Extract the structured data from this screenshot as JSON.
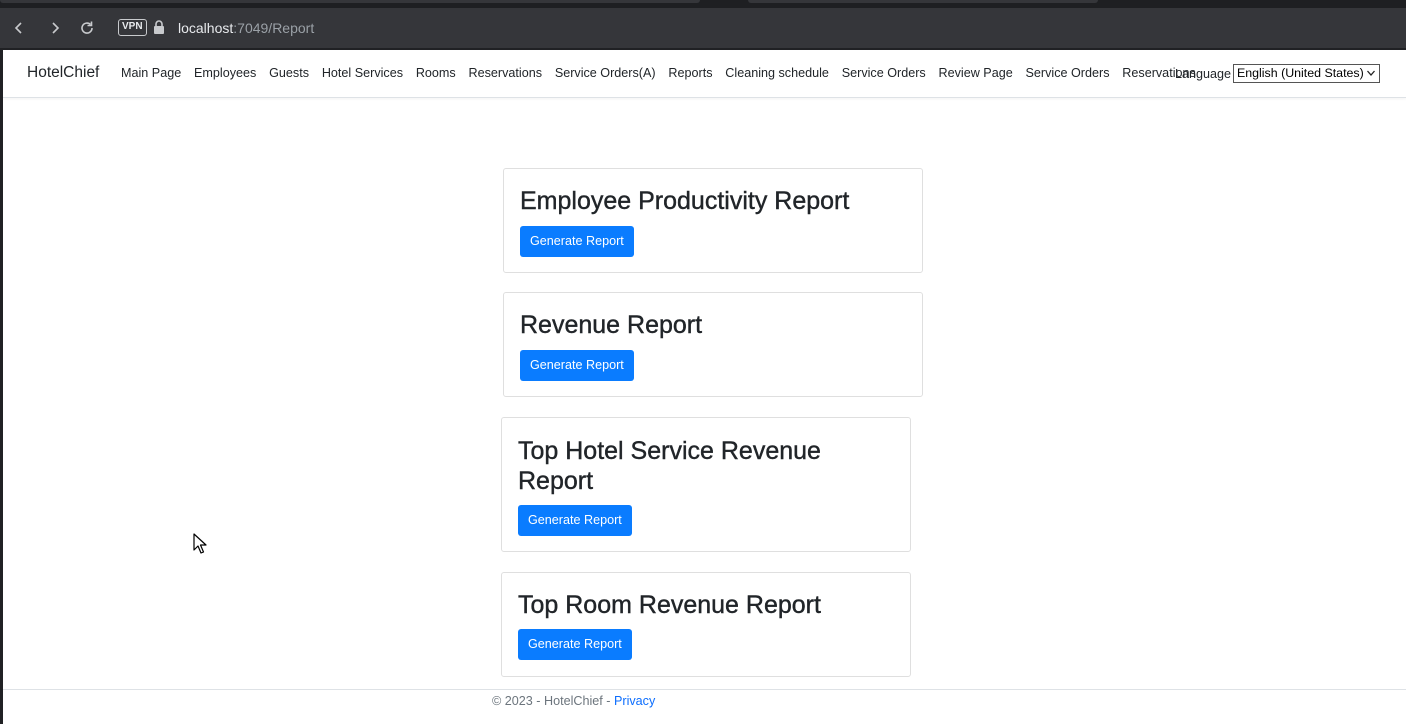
{
  "browser": {
    "url_host": "localhost",
    "url_path": ":7049/Report",
    "vpn_label": "VPN"
  },
  "navbar": {
    "brand": "HotelChief",
    "items": [
      {
        "label": "Main Page"
      },
      {
        "label": "Employees"
      },
      {
        "label": "Guests"
      },
      {
        "label": "Hotel Services"
      },
      {
        "label": "Rooms"
      },
      {
        "label": "Reservations"
      },
      {
        "label": "Service Orders(A)"
      },
      {
        "label": "Reports"
      },
      {
        "label": "Cleaning schedule"
      },
      {
        "label": "Service Orders"
      },
      {
        "label": "Review Page"
      },
      {
        "label": "Service Orders"
      },
      {
        "label": "Reservations"
      }
    ],
    "language_label": "Language",
    "language_selected": "English (United States)"
  },
  "reports": [
    {
      "title": "Employee Productivity Report",
      "button": "Generate Report"
    },
    {
      "title": "Revenue Report",
      "button": "Generate Report"
    },
    {
      "title": "Top Hotel Service Revenue Report",
      "button": "Generate Report"
    },
    {
      "title": "Top Room Revenue Report",
      "button": "Generate Report"
    }
  ],
  "footer": {
    "copyright": "© 2023 - HotelChief - ",
    "privacy_link": "Privacy"
  },
  "colors": {
    "primary": "#0a7cff",
    "link": "#0d6efd",
    "browser_chrome": "#35363a"
  }
}
